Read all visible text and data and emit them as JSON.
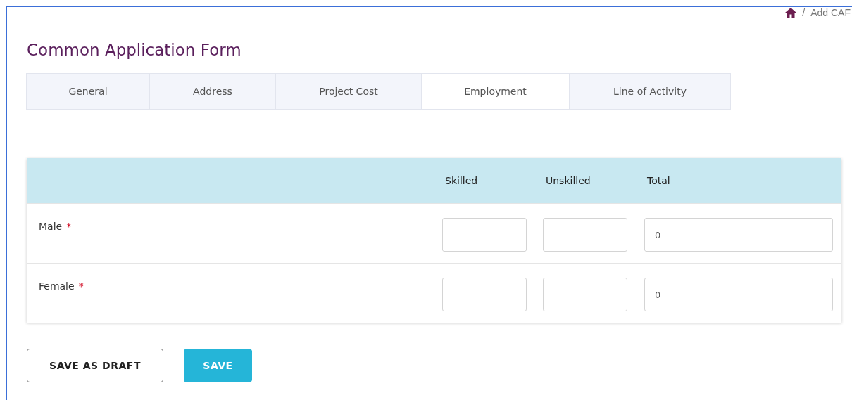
{
  "breadcrumb": {
    "separator": "/",
    "current": "Add CAF"
  },
  "title": "Common Application Form",
  "tabs": [
    {
      "label": "General",
      "selected": false
    },
    {
      "label": "Address",
      "selected": false
    },
    {
      "label": "Project Cost",
      "selected": false
    },
    {
      "label": "Employment",
      "selected": true
    },
    {
      "label": "Line of Activity",
      "selected": false
    }
  ],
  "table": {
    "columns": [
      "Skilled",
      "Unskilled",
      "Total"
    ],
    "rows": [
      {
        "label": "Male",
        "required_mark": "*",
        "skilled": "",
        "unskilled": "",
        "total": "0"
      },
      {
        "label": "Female",
        "required_mark": "*",
        "skilled": "",
        "unskilled": "",
        "total": "0"
      }
    ]
  },
  "buttons": [
    {
      "label": "SAVE AS DRAFT",
      "kind": "outline"
    },
    {
      "label": "SAVE",
      "kind": "primary"
    }
  ]
}
